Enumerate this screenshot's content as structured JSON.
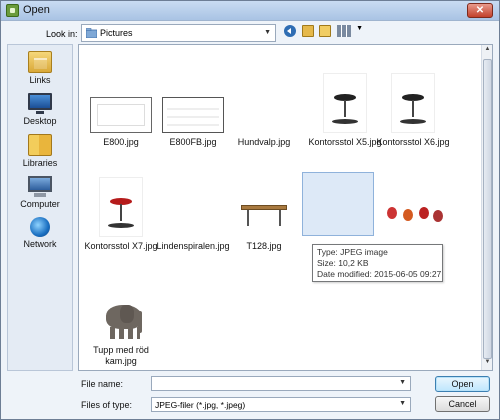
{
  "window": {
    "title": "Open",
    "close_glyph": "✕"
  },
  "toolbar": {
    "look_in_label": "Look in:",
    "look_in_value": "Pictures"
  },
  "places": [
    {
      "label": "Links",
      "icon": "recent-places-icon"
    },
    {
      "label": "Desktop",
      "icon": "desktop-icon"
    },
    {
      "label": "Libraries",
      "icon": "libraries-icon"
    },
    {
      "label": "Computer",
      "icon": "computer-icon"
    },
    {
      "label": "Network",
      "icon": "network-icon"
    }
  ],
  "files": [
    {
      "name": "E800.jpg"
    },
    {
      "name": "E800FB.jpg"
    },
    {
      "name": "Hundvalp.jpg"
    },
    {
      "name": "Kontorsstol X5.jpg"
    },
    {
      "name": "Kontorsstol X6.jpg"
    },
    {
      "name": "Kontorsstol X7.jpg"
    },
    {
      "name": "Lindenspiralen.jpg"
    },
    {
      "name": "T128.jpg"
    },
    {
      "name": ""
    },
    {
      "name": ""
    },
    {
      "name_line1": "Tupp med röd",
      "name_line2": "kam.jpg"
    }
  ],
  "tooltip": {
    "type": "Type: JPEG image",
    "size": "Size: 10,2 KB",
    "modified": "Date modified: 2015-06-05 09:27"
  },
  "bottom": {
    "file_name_label": "File name:",
    "file_name_value": "",
    "files_of_type_label": "Files of type:",
    "files_of_type_value": "JPEG-filer (*.jpg, *.jpeg)",
    "open_label": "Open",
    "cancel_label": "Cancel"
  }
}
